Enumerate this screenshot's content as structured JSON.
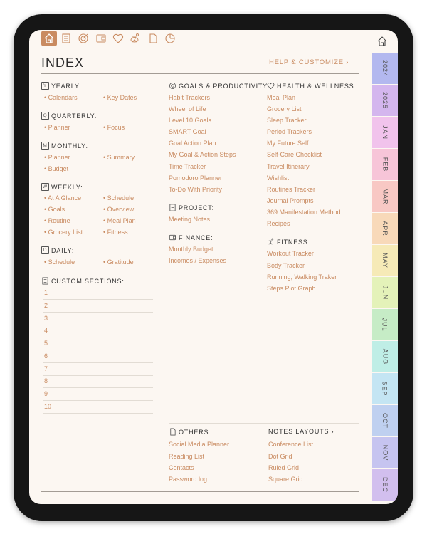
{
  "index": {
    "title": "INDEX",
    "help_label": "HELP & CUSTOMIZE ›"
  },
  "tabs": [
    "2024",
    "2025",
    "JAN",
    "FEB",
    "MAR",
    "APR",
    "MAY",
    "JUN",
    "JUL",
    "AUG",
    "SEP",
    "OCT",
    "NOV",
    "DEC"
  ],
  "tab_colors": [
    "#b3b8ef",
    "#d4b6ee",
    "#f1c3ec",
    "#f7c5d8",
    "#f8c8c4",
    "#f8d9b9",
    "#f6eab7",
    "#e4f2b9",
    "#c6ecc6",
    "#bfeee6",
    "#c4e5f3",
    "#bfd0f0",
    "#c6c4f0",
    "#d2bfee"
  ],
  "yearly": {
    "title": "YEARLY:",
    "icon_letter": "Y",
    "items": [
      "Calendars",
      "Key Dates"
    ]
  },
  "quarterly": {
    "title": "QUARTERLY:",
    "icon_letter": "Q",
    "items": [
      "Planner",
      "Focus"
    ]
  },
  "monthly": {
    "title": "MONTHLY:",
    "icon_letter": "M",
    "items": [
      "Planner",
      "Summary",
      "Budget"
    ]
  },
  "weekly": {
    "title": "WEEKLY:",
    "icon_letter": "W",
    "items": [
      "At A Glance",
      "Schedule",
      "Goals",
      "Overview",
      "Routine",
      "Meal Plan",
      "Grocery List",
      "Fitness"
    ]
  },
  "daily": {
    "title": "DAILY:",
    "icon_letter": "D",
    "items": [
      "Schedule",
      "Gratitude"
    ]
  },
  "custom": {
    "title": "CUSTOM SECTIONS:",
    "numbers": [
      "1",
      "2",
      "3",
      "4",
      "5",
      "6",
      "7",
      "8",
      "9",
      "10"
    ]
  },
  "goals": {
    "title": "GOALS & PRODUCTIVITY:",
    "items": [
      "Habit Trackers",
      "Wheel of Life",
      "Level 10 Goals",
      "SMART Goal",
      "Goal Action Plan",
      "My Goal & Action Steps",
      "Time Tracker",
      "Pomodoro Planner",
      "To-Do With Priority"
    ]
  },
  "project": {
    "title": "PROJECT:",
    "items": [
      "Meeting Notes"
    ]
  },
  "finance": {
    "title": "FINANCE:",
    "items": [
      "Monthly Budget",
      "Incomes / Expenses"
    ]
  },
  "health": {
    "title": "HEALTH & WELLNESS:",
    "items": [
      "Meal Plan",
      "Grocery List",
      "Sleep Tracker",
      "Period Trackers",
      "My Future Self",
      "Self-Care Checklist",
      "Travel Itinerary",
      "Wishlist",
      "Routines Tracker",
      "Journal Prompts",
      "369 Manifestation Method",
      "Recipes"
    ]
  },
  "fitness": {
    "title": "FITNESS:",
    "items": [
      "Workout Tracker",
      "Body Tracker",
      "Running, Walking Traker",
      "Steps Plot Graph"
    ]
  },
  "others": {
    "title": "OTHERS:",
    "items": [
      "Social Media Planner",
      "Reading List",
      "Contacts",
      "Password log"
    ]
  },
  "notes": {
    "title": "NOTES LAYOUTS ›",
    "items": [
      "Conference List",
      "Dot Grid",
      "Ruled Grid",
      "Square Grid"
    ]
  },
  "colors": {
    "accent": "#c98b61",
    "background": "#fcf7f2",
    "device": "#161616"
  }
}
